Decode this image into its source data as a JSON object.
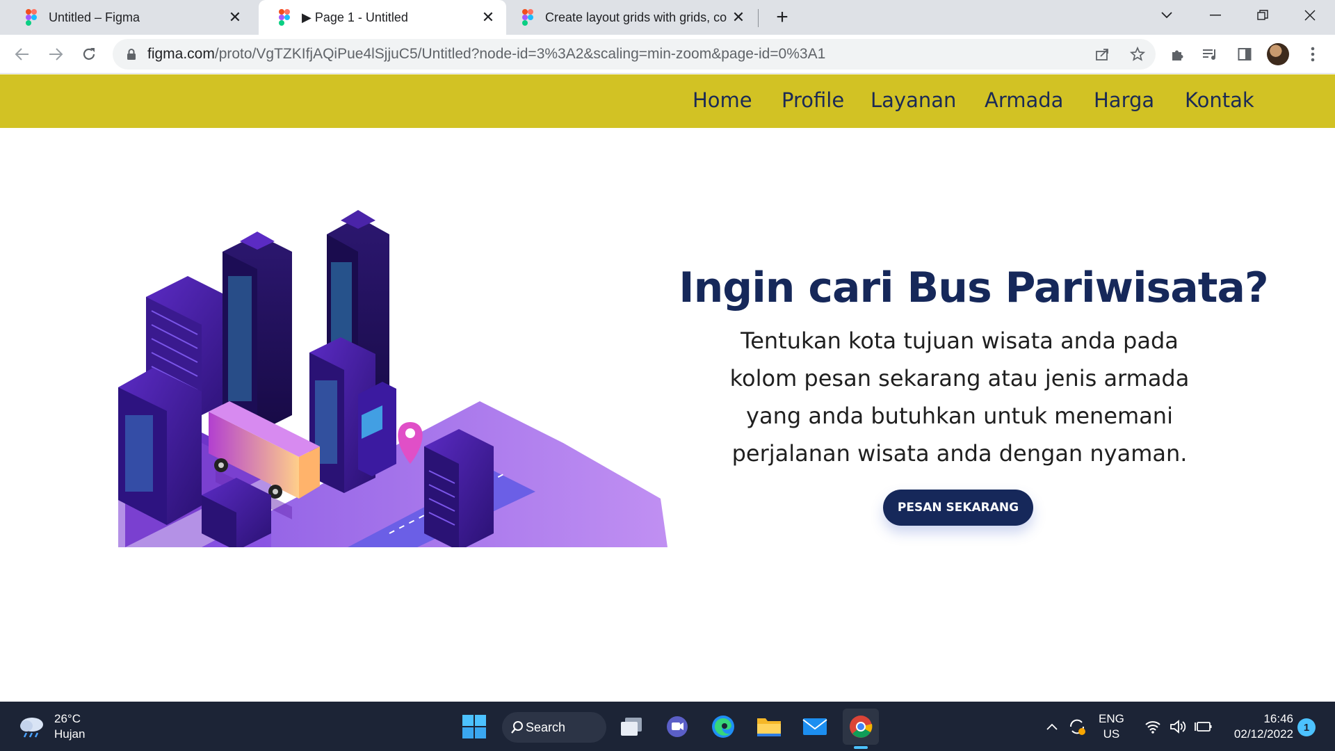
{
  "browser": {
    "tabs": [
      {
        "title": "Untitled – Figma",
        "active": false
      },
      {
        "title": "▶ Page 1 - Untitled",
        "active": true
      },
      {
        "title": "Create layout grids with grids, co",
        "active": false
      }
    ],
    "url_domain": "figma.com",
    "url_path": "/proto/VgTZKIfjAQiPue4lSjjuC5/Untitled?node-id=3%3A2&scaling=min-zoom&page-id=0%3A1"
  },
  "site": {
    "nav": [
      "Home",
      "Profile",
      "Layanan",
      "Armada",
      "Harga",
      "Kontak"
    ],
    "hero_title": "Ingin cari Bus Pariwisata?",
    "hero_text": "Tentukan kota tujuan wisata anda pada kolom pesan sekarang atau jenis armada yang anda butuhkan untuk menemani perjalanan wisata anda dengan nyaman.",
    "cta_label": "PESAN SEKARANG",
    "colors": {
      "nav_bg": "#d2c224",
      "title": "#16285a",
      "button": "#16285a"
    }
  },
  "taskbar": {
    "weather_temp": "26°C",
    "weather_desc": "Hujan",
    "search_label": "Search",
    "lang_top": "ENG",
    "lang_bottom": "US",
    "time": "16:46",
    "date": "02/12/2022",
    "notifications": "1"
  }
}
